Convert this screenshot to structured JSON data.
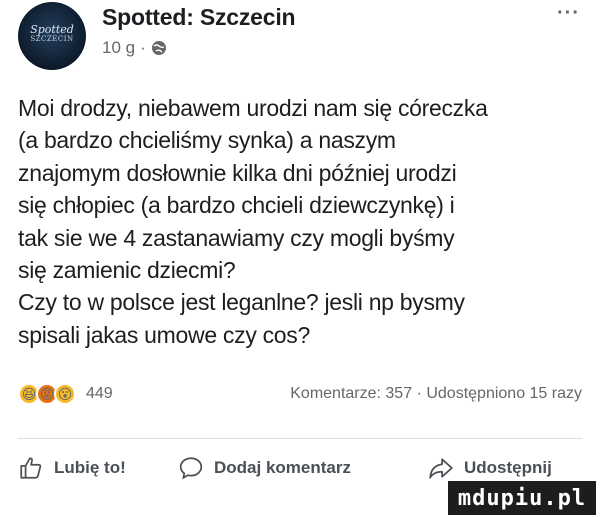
{
  "header": {
    "avatar_text_top": "Spotted",
    "avatar_text_bottom": "SZCZECIN",
    "page_name": "Spotted: Szczecin",
    "time": "10 g",
    "separator": "·",
    "more_label": "···",
    "privacy_icon": "globe-icon"
  },
  "post": {
    "lines": [
      "Moi drodzy, niebawem urodzi nam się córeczka",
      "(a bardzo chcieliśmy synka) a naszym",
      "znajomym dosłownie kilka dni później urodzi",
      "się chłopiec (a bardzo chcieli dziewczynkę) i",
      "tak sie we 4 zastanawiamy czy mogli byśmy",
      "się zamienic dziecmi?",
      "Czy to w polsce jest leganlne? jesli np bysmy",
      "spisali jakas umowe czy cos?"
    ]
  },
  "stats": {
    "reaction_icons": [
      "haha-icon",
      "angry-icon",
      "wow-icon"
    ],
    "reaction_count": "449",
    "comments": "Komentarze: 357",
    "dot": "·",
    "shares": "Udostępniono 15 razy"
  },
  "actions": {
    "like_label": "Lubię to!",
    "comment_label": "Dodaj komentarz",
    "share_label": "Udostępnij"
  },
  "watermark": {
    "text": "mdupiu.pl"
  },
  "colors": {
    "text": "#1c1e21",
    "secondary": "#65676b",
    "divider": "#dadde1",
    "avatar_bg": "#0d1a2a"
  }
}
